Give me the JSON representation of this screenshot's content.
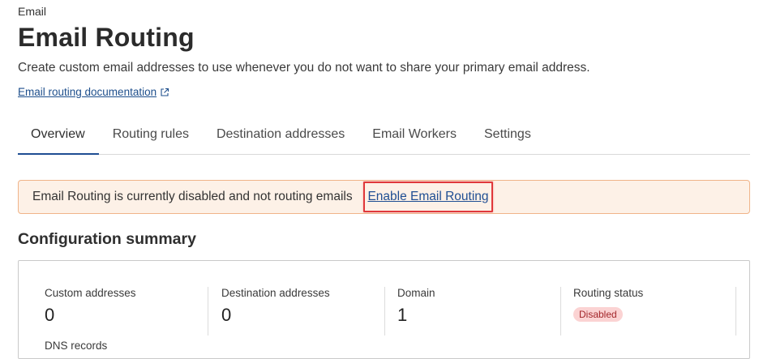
{
  "header": {
    "eyebrow": "Email",
    "title": "Email Routing",
    "subtitle": "Create custom email addresses to use whenever you do not want to share your primary email address.",
    "doc_link": "Email routing documentation"
  },
  "tabs": [
    {
      "label": "Overview",
      "active": true
    },
    {
      "label": "Routing rules"
    },
    {
      "label": "Destination addresses"
    },
    {
      "label": "Email Workers"
    },
    {
      "label": "Settings"
    }
  ],
  "banner": {
    "message": "Email Routing is currently disabled and not routing emails",
    "action": "Enable Email Routing"
  },
  "summary": {
    "title": "Configuration summary",
    "metrics": [
      {
        "label": "Custom addresses",
        "value": "0"
      },
      {
        "label": "Destination addresses",
        "value": "0"
      },
      {
        "label": "Domain",
        "value": "1"
      },
      {
        "label": "Routing status",
        "badge": "Disabled"
      }
    ],
    "dns_label": "DNS records"
  },
  "colors": {
    "link": "#1f4e93",
    "banner_bg": "#fdf1e7",
    "banner_border": "#f0b489",
    "highlight": "#e0383b",
    "badge_bg": "#fbd3d3",
    "badge_text": "#a3262a"
  }
}
